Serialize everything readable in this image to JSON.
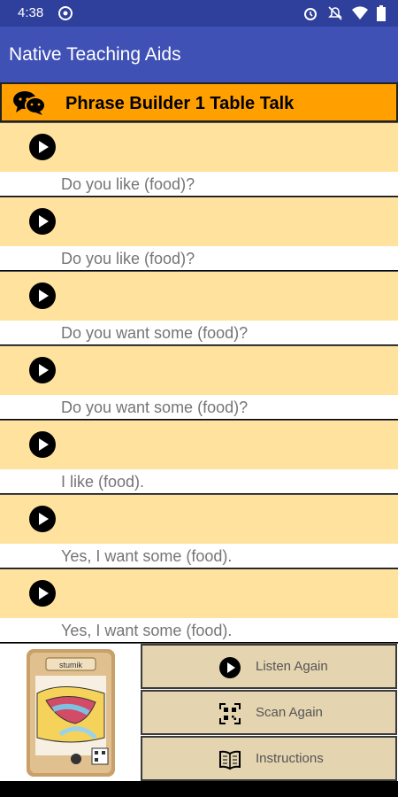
{
  "status_bar": {
    "time": "4:38",
    "icons": [
      "vpn-icon",
      "alarm-icon",
      "notifications-off-icon",
      "wifi-icon",
      "battery-icon"
    ]
  },
  "app_bar": {
    "title": "Native Teaching Aids"
  },
  "lesson": {
    "title": "Phrase Builder 1 Table Talk",
    "icon": "chat-bubbles-icon"
  },
  "phrases": [
    {
      "text": "Do you like (food)?"
    },
    {
      "text": "Do you like (food)?"
    },
    {
      "text": "Do you want some (food)?"
    },
    {
      "text": "Do you want some (food)?"
    },
    {
      "text": "I like (food)."
    },
    {
      "text": "Yes, I want some (food)."
    },
    {
      "text": "Yes, I want some (food)."
    }
  ],
  "card": {
    "label": "stumik",
    "icon": "card-illustration"
  },
  "actions": [
    {
      "label": "Listen Again",
      "icon": "play-icon"
    },
    {
      "label": "Scan Again",
      "icon": "qr-scan-icon"
    },
    {
      "label": "Instructions",
      "icon": "book-icon"
    }
  ],
  "colors": {
    "status_bar": "#2e3f9c",
    "app_bar": "#3f51b5",
    "header": "#ffa000",
    "play_band": "#ffe29e",
    "button": "#e4d4b0"
  }
}
